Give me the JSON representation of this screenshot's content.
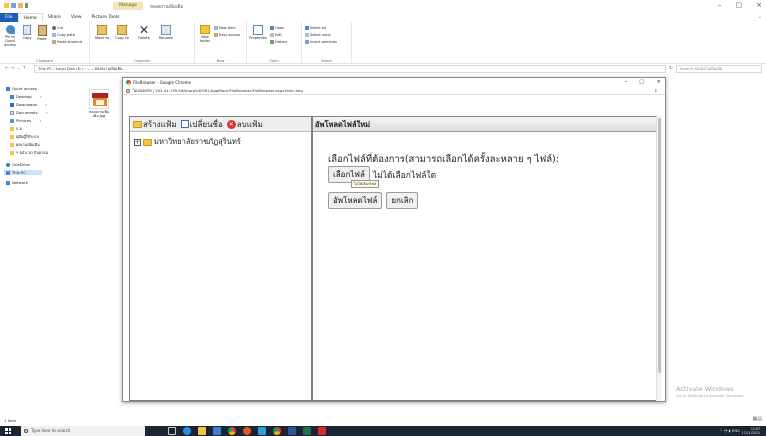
{
  "explorer": {
    "manage_tab": "Manage",
    "window_title": "หลงลงานเพิ่มเติม",
    "window_controls": [
      "–",
      "▢",
      "×"
    ],
    "ribbon_tabs": [
      "File",
      "Home",
      "Share",
      "View",
      "Picture Tools"
    ],
    "ribbon": {
      "clipboard": {
        "pin_label": "Pin to Quick access",
        "copy_label": "Copy",
        "paste_label": "Paste",
        "cut_label": "Cut",
        "copy_path_label": "Copy path",
        "paste_shortcut_label": "Paste shortcut",
        "caption": "Clipboard"
      },
      "organize": {
        "move_label": "Move to",
        "copy_to_label": "Copy to",
        "delete_label": "Delete",
        "rename_label": "Rename",
        "caption": "Organize"
      },
      "new": {
        "new_folder_label": "New folder",
        "new_item_label": "New item",
        "easy_access_label": "Easy access",
        "caption": "New"
      },
      "open": {
        "properties_label": "Properties",
        "open_label": "Open",
        "edit_label": "Edit",
        "history_label": "History",
        "caption": "Open"
      },
      "select": {
        "select_all_label": "Select all",
        "select_none_label": "Select none",
        "invert_label": "Invert selection",
        "caption": "Select"
      }
    },
    "address": "This PC  ›  Local Disk (E:)  ›  ...  ›  หลงลงานเพิ่มเติม",
    "search_placeholder": "Search หลงลงานเพิ่มเติม",
    "nav_items": [
      "Quick access",
      "Desktop",
      "Downloads",
      "Documents",
      "Pictures",
      "ก.อ",
      "คู่มือผู้ใช้ระบบ",
      "ผลงานเพิ่มเติม",
      "ฯ ฉบับ 30 กันยายน",
      "OneDrive",
      "This PC",
      "Network"
    ],
    "file_item": {
      "name": "หลงลงานเพิ่มเติม.jpg"
    },
    "status": "1 item"
  },
  "popup": {
    "title": "FileBrowser - Google Chrome",
    "url_secure": "ไม่ปลอดภัย",
    "url": "202.44.139.56/sharp2d2561/AppBlock/FileBrowser/FileBrowser.aspx?ext=img",
    "controls": [
      "–",
      "▢",
      "×"
    ],
    "left_frame": {
      "create_folder": "สร้างแฟ้ม",
      "rename": "เปลี่ยนชื่อ",
      "delete": "ลบแฟ้ม",
      "tree_root": "มหาวิทยาลัยราชภัฏสุรินทร์"
    },
    "right_frame": {
      "header": "อัพโหลดไฟล์ใหม่",
      "instruction": "เลือกไฟล์ที่ต้องการ(สามารถเลือกได้ครั้งละหลาย ๆ ไฟล์):",
      "choose_button": "เลือกไฟล์",
      "no_file_text": "ไม่ได้เลือกไฟล์ใด",
      "tooltip": "ไม่ได้เลือกไฟล์",
      "upload_button": "อัพโหลดไฟล์",
      "cancel_button": "ยกเลิก"
    }
  },
  "watermark": {
    "line1": "Activate Windows",
    "line2": "Go to Settings to activate Windows."
  },
  "taskbar": {
    "search_placeholder": "Type here to search",
    "tray_lang": "ENG",
    "time": "11:07",
    "date": "17/11/2021"
  }
}
